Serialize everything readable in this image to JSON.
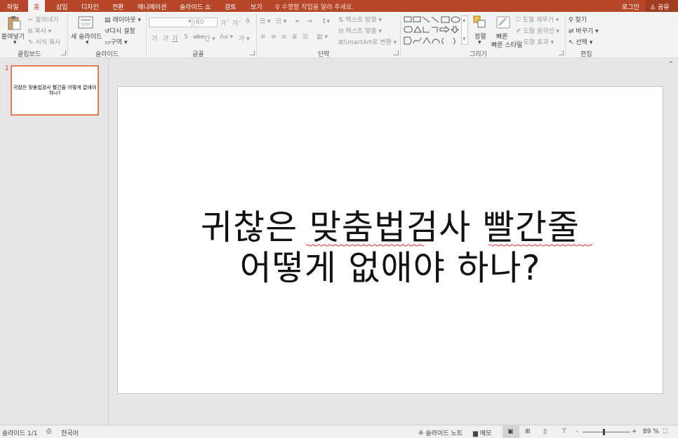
{
  "menu": {
    "tabs": [
      "파일",
      "홈",
      "삽입",
      "디자인",
      "전환",
      "애니메이션",
      "슬라이드 쇼",
      "검토",
      "보기"
    ],
    "tell_me": "수행할 작업을 알려 주세요.",
    "login": "로그인",
    "share": "공유"
  },
  "ribbon": {
    "clipboard": {
      "label": "클립보드",
      "paste": "붙여넣기",
      "cut": "잘라내기",
      "copy": "복사",
      "format_painter": "서식 복사"
    },
    "slides": {
      "label": "슬라이드",
      "new_slide": "새 슬라이드",
      "layout": "레이아웃",
      "reset": "다시 설정",
      "section": "구역"
    },
    "font": {
      "label": "글꼴",
      "font_size": "60"
    },
    "paragraph": {
      "label": "단락",
      "text_direction": "텍스트 방향",
      "align_text": "텍스트 맞춤",
      "smartart": "SmartArt로 변환"
    },
    "drawing": {
      "label": "그리기",
      "arrange": "정렬",
      "quick_styles": "빠른 스타일",
      "shape_fill": "도형 채우기",
      "shape_outline": "도형 윤곽선",
      "shape_effects": "도형 효과"
    },
    "editing": {
      "label": "편집",
      "find": "찾기",
      "replace": "바꾸기",
      "select": "선택"
    }
  },
  "thumbnails": [
    {
      "number": "1",
      "text": "귀찮은 맞춤법검사 빨간줄 어떻게 없애야 하나?"
    }
  ],
  "slide": {
    "title_line1": "귀찮은 맞춤법검사 빨간줄",
    "title_line2": "어떻게 없애야 하나?"
  },
  "status": {
    "slide_count": "슬라이드 1/1",
    "language": "한국어",
    "notes": "슬라이드 노트",
    "comments": "메모",
    "zoom": "89 %"
  },
  "colors": {
    "accent": "#b7472a",
    "selection": "#e37c57"
  }
}
